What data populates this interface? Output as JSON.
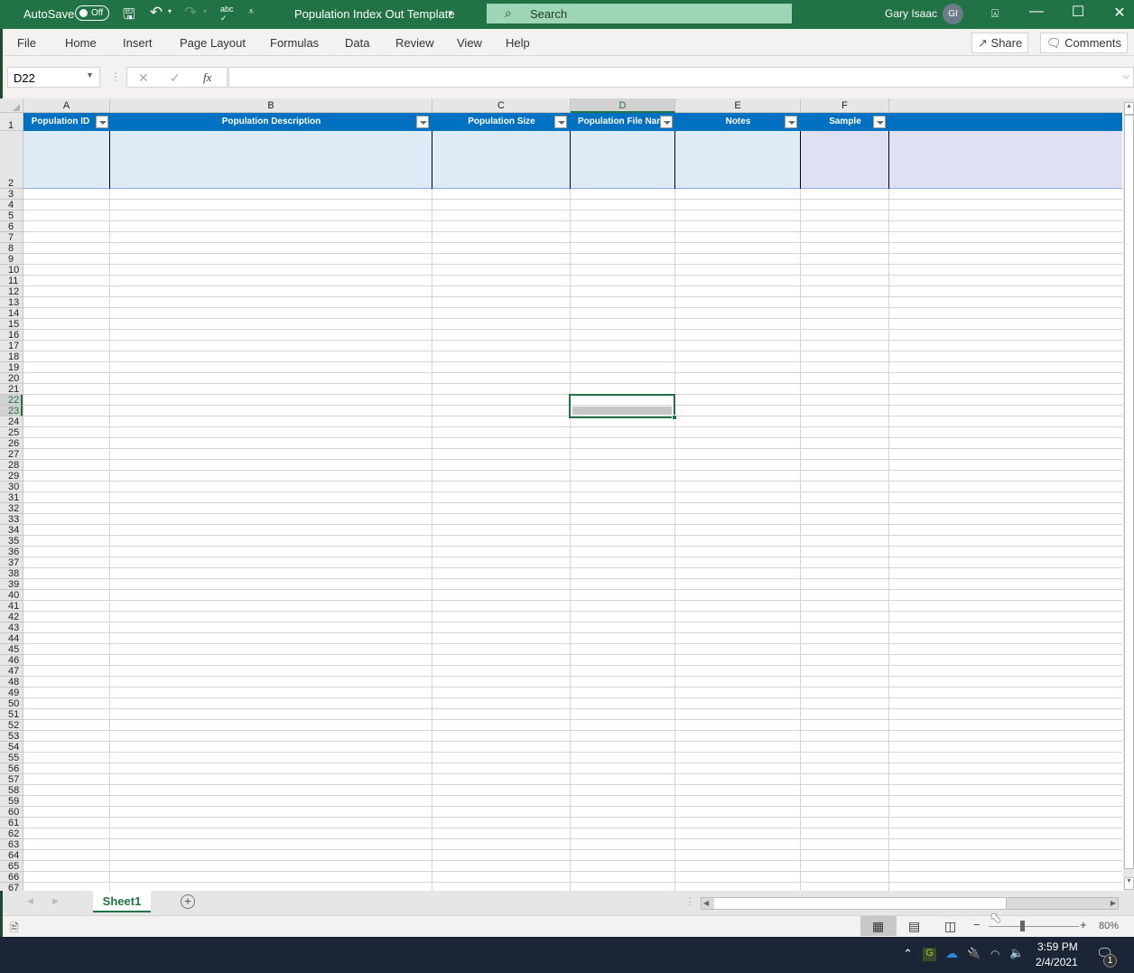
{
  "titlebar": {
    "autosave_label": "AutoSave",
    "autosave_state": "Off",
    "document_title": "Population Index Out Template",
    "search_placeholder": "Search",
    "user_name": "Gary Isaac",
    "user_initials": "GI",
    "icons": [
      "save-icon",
      "undo-icon",
      "redo-icon",
      "spelling-icon",
      "customize-toolbar-icon",
      "ribbon-display-icon",
      "minimize-icon",
      "maximize-icon",
      "close-icon"
    ]
  },
  "menu": {
    "items": [
      "File",
      "Home",
      "Insert",
      "Page Layout",
      "Formulas",
      "Data",
      "Review",
      "View",
      "Help"
    ],
    "share_label": "Share",
    "comments_label": "Comments"
  },
  "formula_bar": {
    "name_box": "D22",
    "formula": ""
  },
  "sheet": {
    "columns": [
      "A",
      "B",
      "C",
      "D",
      "E",
      "F"
    ],
    "selected_column": "D",
    "table_headers": [
      "Population ID",
      "Population Description",
      "Population Size",
      "Population File Nam",
      "Notes",
      "Sample"
    ],
    "selected_rows": [
      22,
      23
    ],
    "selected_cell": "D22",
    "first_row": 1,
    "last_row": 67
  },
  "tabs": {
    "sheets": [
      "Sheet1"
    ],
    "active": "Sheet1"
  },
  "status": {
    "zoom": "80%",
    "zoom_percent": 80
  },
  "taskbar": {
    "time": "3:59 PM",
    "date": "2/4/2021",
    "notification_count": "1"
  },
  "colors": {
    "excel_green": "#217346",
    "header_blue": "#0070c0",
    "row_band": "#ddebf7"
  }
}
